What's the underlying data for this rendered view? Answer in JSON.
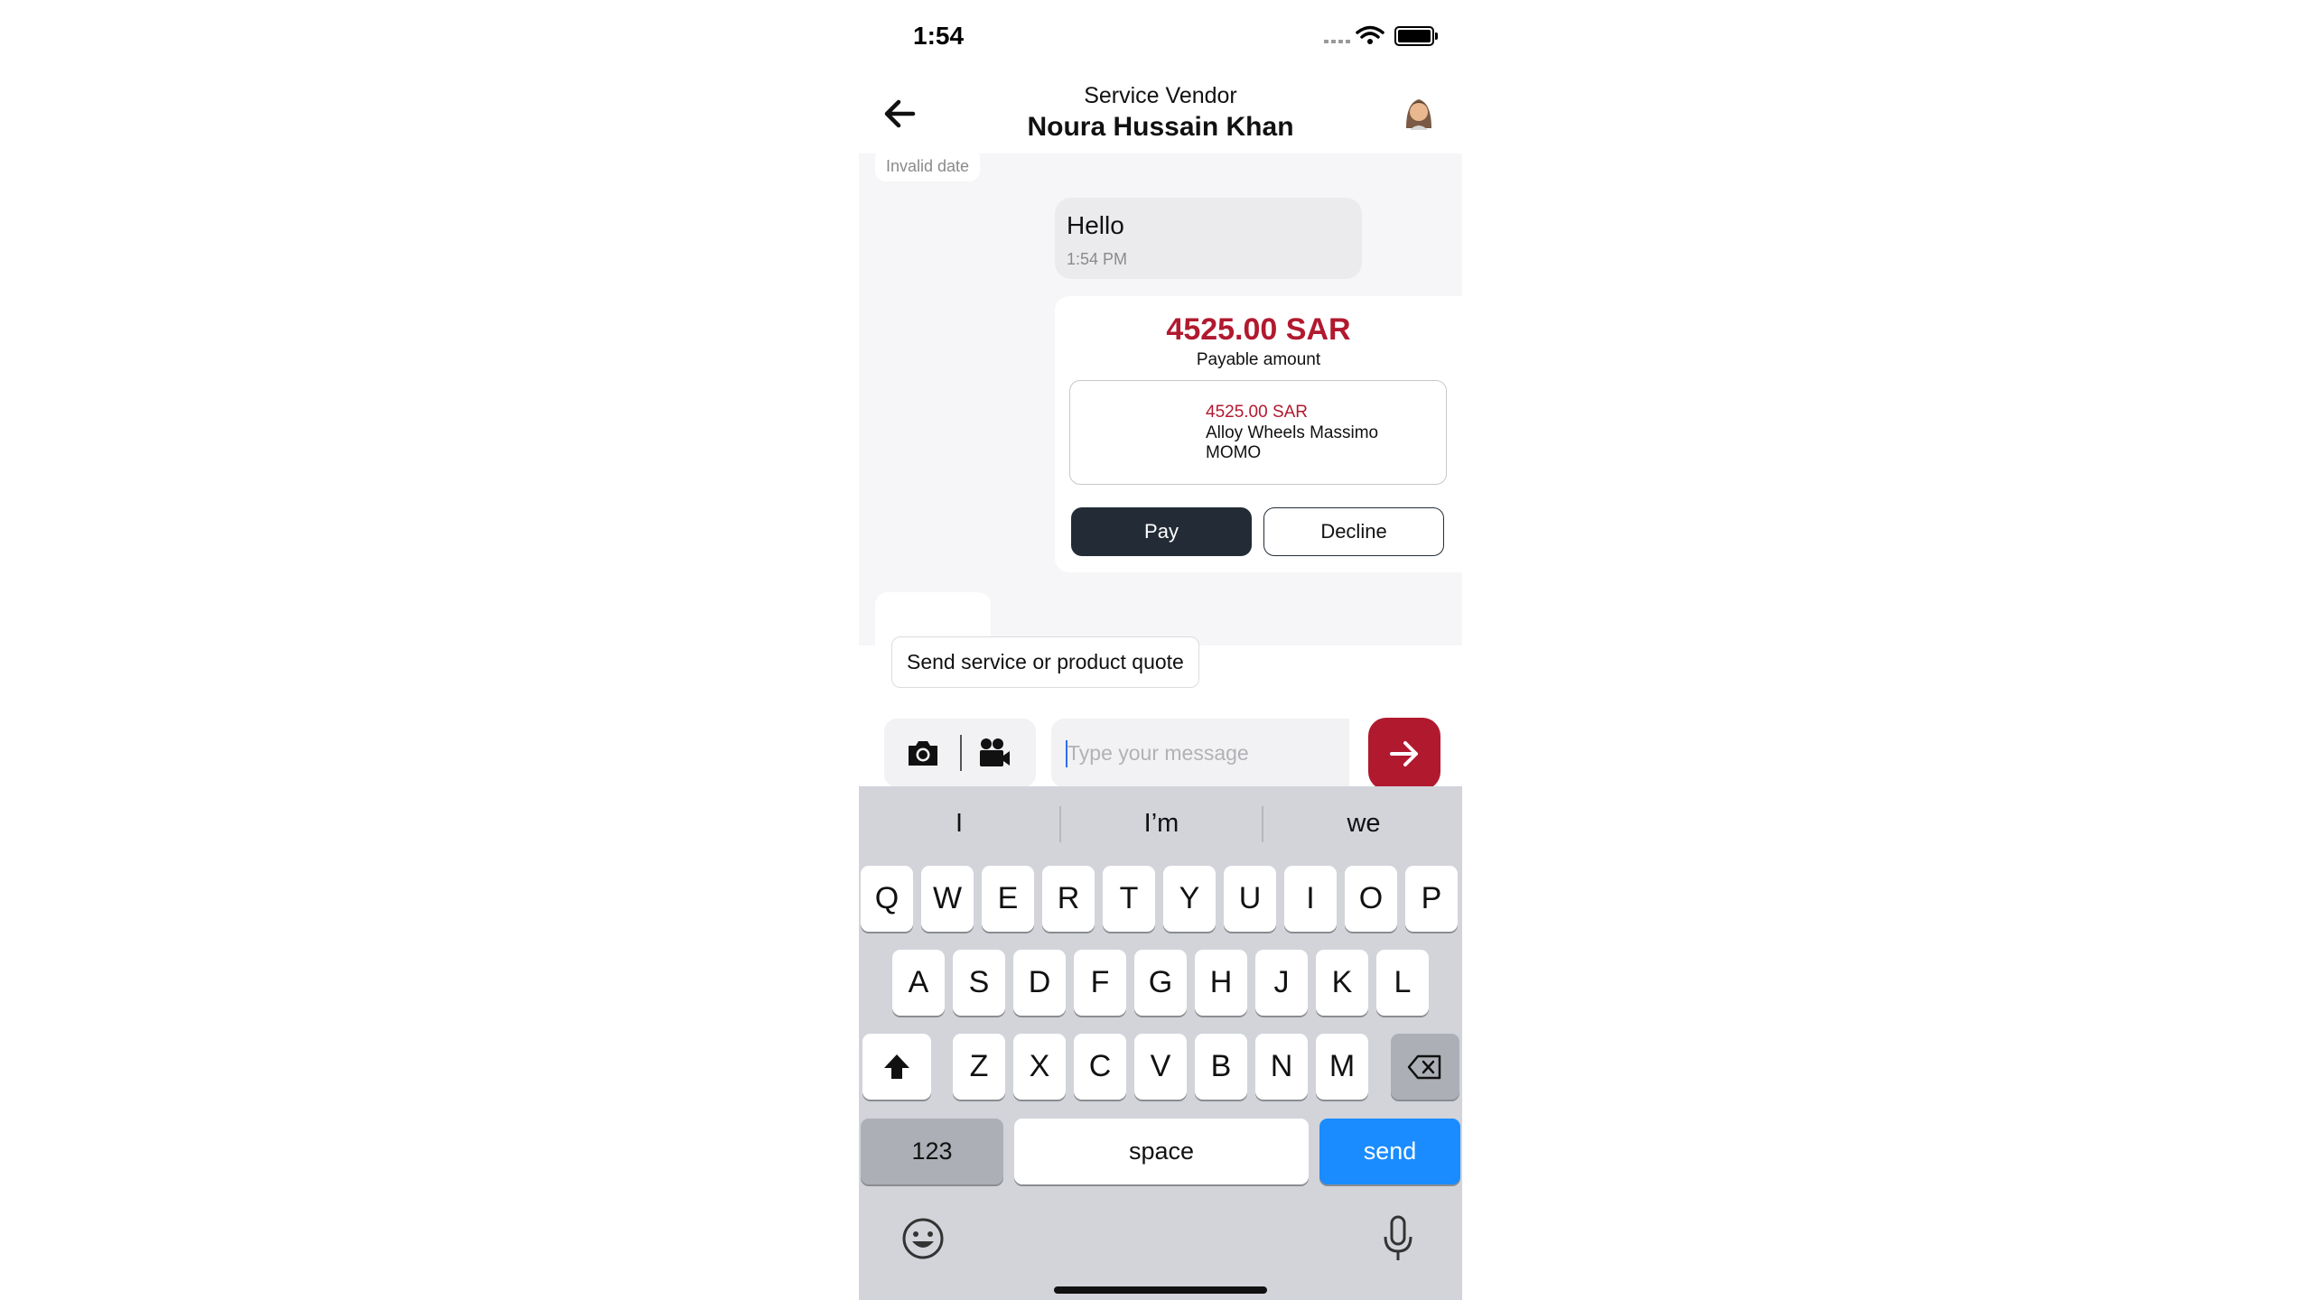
{
  "status_bar": {
    "time": "1:54"
  },
  "header": {
    "subtitle": "Service Vendor",
    "title": "Noura Hussain Khan"
  },
  "chat": {
    "date_label": "Invalid date",
    "message": {
      "text": "Hello",
      "time": "1:54 PM"
    },
    "quote": {
      "amount": "4525.00 SAR",
      "amount_label": "Payable amount",
      "item": {
        "price": "4525.00 SAR",
        "name": "Alloy Wheels Massimo MOMO"
      },
      "pay_label": "Pay",
      "decline_label": "Decline"
    }
  },
  "suggestion": "Send service or product quote",
  "composer": {
    "placeholder": "Type your message"
  },
  "keyboard": {
    "predictions": [
      "I",
      "I’m",
      "we"
    ],
    "row1": [
      "Q",
      "W",
      "E",
      "R",
      "T",
      "Y",
      "U",
      "I",
      "O",
      "P"
    ],
    "row2": [
      "A",
      "S",
      "D",
      "F",
      "G",
      "H",
      "J",
      "K",
      "L"
    ],
    "row3": [
      "Z",
      "X",
      "C",
      "V",
      "B",
      "N",
      "M"
    ],
    "numbers_label": "123",
    "space_label": "space",
    "send_label": "send"
  },
  "colors": {
    "accent": "#b1192f",
    "pay_button": "#232c36",
    "keyboard_send": "#1a8cff"
  }
}
